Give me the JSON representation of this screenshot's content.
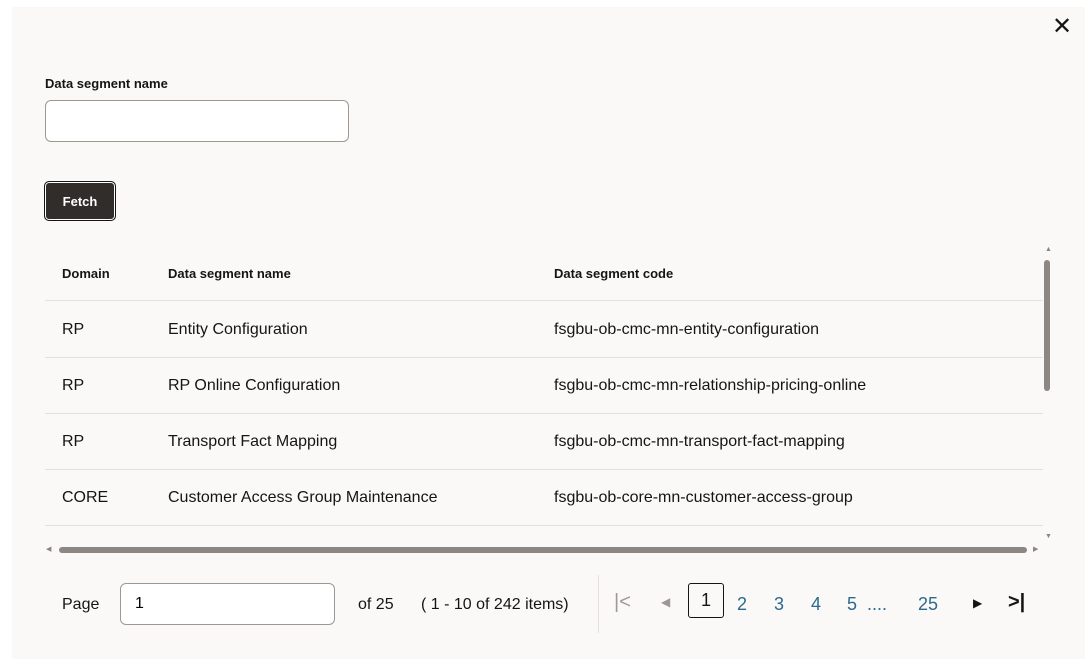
{
  "dialog": {
    "close_icon": "✕"
  },
  "form": {
    "label": "Data segment name",
    "value": "",
    "placeholder": "",
    "fetch_label": "Fetch"
  },
  "table": {
    "columns": [
      "Domain",
      "Data segment name",
      "Data segment code"
    ],
    "rows": [
      {
        "domain": "RP",
        "name": "Entity Configuration",
        "code": "fsgbu-ob-cmc-mn-entity-configuration"
      },
      {
        "domain": "RP",
        "name": "RP Online Configuration",
        "code": "fsgbu-ob-cmc-mn-relationship-pricing-online"
      },
      {
        "domain": "RP",
        "name": "Transport Fact Mapping",
        "code": "fsgbu-ob-cmc-mn-transport-fact-mapping"
      },
      {
        "domain": "CORE",
        "name": "Customer Access Group Maintenance",
        "code": "fsgbu-ob-core-mn-customer-access-group"
      }
    ]
  },
  "pagination": {
    "page_label": "Page",
    "page_value": "1",
    "of_text": "of 25",
    "range_text": "( 1 - 10 of 242 items)",
    "first_icon": "|<",
    "prev_icon": "◀",
    "current": "1",
    "pages": [
      "2",
      "3",
      "4",
      "5"
    ],
    "ellipsis": "....",
    "last_page": "25",
    "next_icon": "▶",
    "last_icon": ">|"
  },
  "colors": {
    "dialog_bg": "#fbf9f8",
    "button_bg": "#312d2a",
    "link": "#2b6a8e"
  }
}
